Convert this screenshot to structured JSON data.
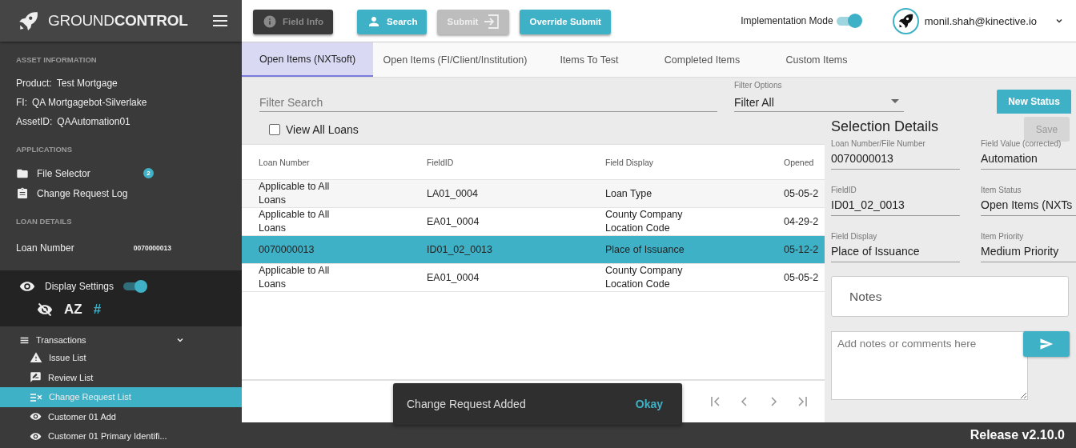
{
  "brand": {
    "logo_text": "GROUND**CONTROL**"
  },
  "asset_information": {
    "heading": "ASSET INFORMATION",
    "fields": [
      {
        "label": "Product:",
        "value": "Test Mortgage"
      },
      {
        "label": "FI:",
        "value": "QA Mortgagebot-Silverlake"
      },
      {
        "label": "AssetID:",
        "value": "QAAutomation01"
      }
    ]
  },
  "applications": {
    "heading": "APPLICATIONS",
    "items": [
      {
        "kind": "folder",
        "label": "File Selector",
        "badge": "2"
      },
      {
        "kind": "clipboard",
        "label": "Change Request Log"
      }
    ]
  },
  "loan_details": {
    "heading": "LOAN DETAILS",
    "label": "Loan Number",
    "value": "0070000013"
  },
  "display_settings": {
    "label": "Display Settings",
    "on": true,
    "options": [
      {
        "kind": "hide",
        "selected": false
      },
      {
        "kind": "glyph",
        "label": "AZ",
        "selected": false
      },
      {
        "kind": "glyph",
        "label": "#",
        "selected": true
      }
    ]
  },
  "transactions": {
    "label": "Transactions",
    "expanded": true,
    "children": [
      {
        "kind": "warning",
        "label": "Issue List",
        "selected": false
      },
      {
        "kind": "review",
        "label": "Review List",
        "selected": false
      },
      {
        "kind": "change",
        "label": "Change Request List",
        "selected": true
      },
      {
        "kind": "eye",
        "label": "Customer 01 Add",
        "selected": false
      },
      {
        "kind": "eye",
        "label": "Customer 01 Primary Identifi...",
        "selected": false
      }
    ]
  },
  "toolbar": {
    "buttons": [
      {
        "kind": "info",
        "label": "Field Info",
        "disabled": true
      },
      {
        "kind": "search",
        "label": "Search",
        "disabled": false
      },
      {
        "kind": "submit",
        "label": "Submit",
        "disabled": true
      },
      {
        "kind": "plain",
        "label": "Override Submit",
        "disabled": false
      }
    ]
  },
  "implementation_mode": {
    "label": "Implementation Mode",
    "on": true
  },
  "user": {
    "email": "monil.shah@kinective.io"
  },
  "tabs": [
    {
      "label": "Open Items (NXTsoft)",
      "selected": true
    },
    {
      "label": "Open Items (FI/Client/Institution)",
      "selected": false
    },
    {
      "label": "Items To Test",
      "selected": false
    },
    {
      "label": "Completed Items",
      "selected": false
    },
    {
      "label": "Custom Items",
      "selected": false
    }
  ],
  "filter": {
    "search_placeholder": "Filter Search",
    "options_label": "Filter Options",
    "options_value": "Filter All",
    "new_status_button": "New Status"
  },
  "view_all_loans": {
    "label": "View All Loans",
    "checked": false
  },
  "table": {
    "columns": [
      "Loan Number",
      "FieldID",
      "Field Display",
      "Opened"
    ],
    "rows": [
      {
        "cells": [
          "Applicable to All Loans",
          "LA01_0004",
          "Loan Type",
          "05-05-2"
        ],
        "selected": false
      },
      {
        "cells": [
          "Applicable to All Loans",
          "EA01_0004",
          "County Company Location Code",
          "04-29-2"
        ],
        "selected": false
      },
      {
        "cells": [
          "0070000013",
          "ID01_02_0013",
          "Place of Issuance",
          "05-12-2"
        ],
        "selected": true
      },
      {
        "cells": [
          "Applicable to All Loans",
          "EA01_0004",
          "County Company Location Code",
          "05-05-2"
        ],
        "selected": false
      }
    ]
  },
  "toast": {
    "message": "Change Request Added",
    "action": "Okay"
  },
  "selection_details": {
    "title": "Selection Details",
    "save_button": {
      "label": "Save",
      "disabled": true
    },
    "fields": [
      {
        "label": "Loan Number/File Number",
        "value": "0070000013"
      },
      {
        "label": "Field Value (corrected)",
        "value": "Automation"
      },
      {
        "label": "FieldID",
        "value": "ID01_02_0013"
      },
      {
        "label": "Item Status",
        "value": "Open Items (NXTs"
      },
      {
        "label": "Field Display",
        "value": "Place of Issuance"
      },
      {
        "label": "Item Priority",
        "value": "Medium Priority"
      }
    ],
    "notes_heading": "Notes",
    "comment_placeholder": "Add notes or comments here"
  },
  "footer": {
    "release": "Release v2.10.0"
  }
}
